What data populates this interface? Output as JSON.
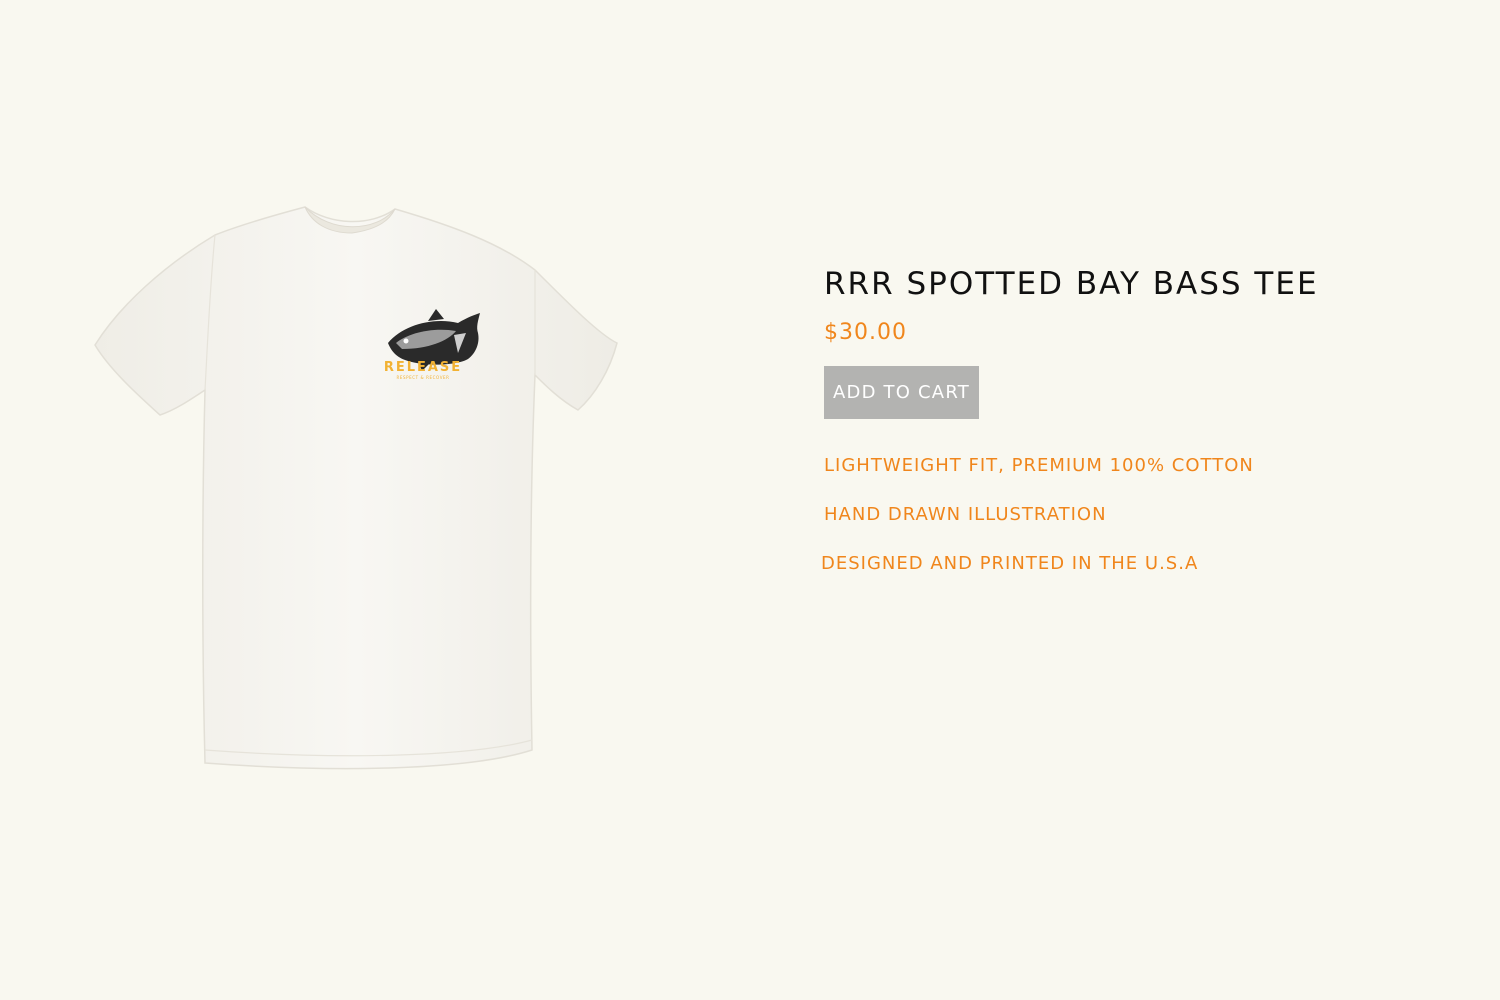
{
  "product": {
    "image_alt": "White t-shirt with fish illustration and RELEASE chest print",
    "print": {
      "word": "RELEASE",
      "tagline": "RESPECT & RECOVER"
    },
    "title": "RRR SPOTTED BAY BASS TEE",
    "price": "$30.00",
    "add_to_cart_label": "ADD TO CART",
    "features": [
      "LIGHTWEIGHT FIT, PREMIUM 100% COTTON",
      "HAND DRAWN ILLUSTRATION",
      "DESIGNED AND PRINTED IN THE U.S.A"
    ]
  },
  "colors": {
    "background": "#f9f8f0",
    "accent": "#f0861c",
    "button": "#b3b3b1",
    "shirt": "#f6f5f1",
    "print_yellow": "#f2b233"
  }
}
